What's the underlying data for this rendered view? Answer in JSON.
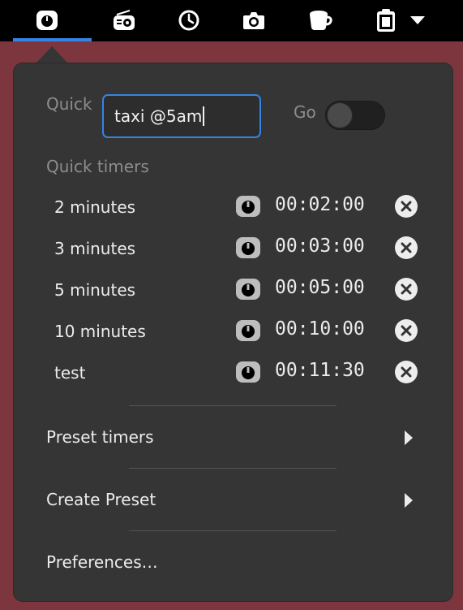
{
  "topbar": {
    "icons": [
      "timer-icon",
      "radio-icon",
      "clock-icon",
      "camera-icon",
      "coffee-cup-icon",
      "clipboard-icon",
      "dropdown-arrow-icon"
    ]
  },
  "quick": {
    "label": "Quick",
    "input_value": "taxi @5am",
    "go_label": "Go",
    "go_enabled": false
  },
  "quick_timers": {
    "heading": "Quick timers",
    "items": [
      {
        "name": "2 minutes",
        "time": "00:02:00"
      },
      {
        "name": "3 minutes",
        "time": "00:03:00"
      },
      {
        "name": "5 minutes",
        "time": "00:05:00"
      },
      {
        "name": "10 minutes",
        "time": "00:10:00"
      },
      {
        "name": "test",
        "time": "00:11:30"
      }
    ]
  },
  "menu": {
    "preset_timers": "Preset timers",
    "create_preset": "Create Preset",
    "preferences": "Preferences…"
  },
  "colors": {
    "panel_background": "#000000",
    "desktop_background": "#7e363e",
    "popover_background": "#353535",
    "accent": "#3584e4"
  }
}
